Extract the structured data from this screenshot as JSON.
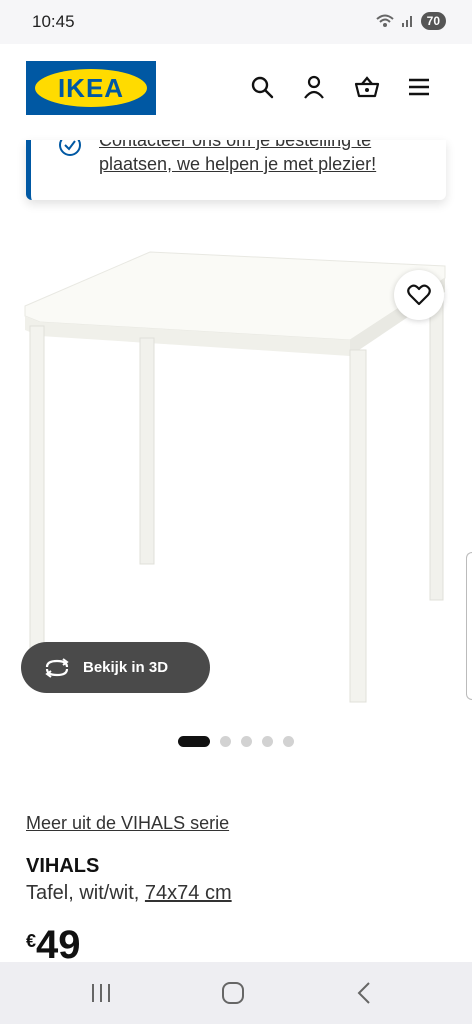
{
  "status": {
    "time": "10:45",
    "battery": "70"
  },
  "header": {
    "logo_text": "IKEA",
    "brand_blue": "#0058a3",
    "brand_yellow": "#ffdb00"
  },
  "notice": {
    "line1": "Contacteer ons om je bestelling te",
    "line2": "plaatsen, we helpen je met plezier!"
  },
  "gallery": {
    "view3d_label": "Bekijk in 3D",
    "dot_count": 5,
    "active_index": 0
  },
  "product": {
    "series_link": "Meer uit de VIHALS serie",
    "name": "VIHALS",
    "desc_prefix": "Tafel, wit/wit, ",
    "size": "74x74 cm",
    "currency": "€",
    "price": "49"
  },
  "icons": [
    "search-icon",
    "user-icon",
    "cart-icon",
    "menu-icon",
    "heart-icon",
    "rotate-3d-icon",
    "recents-icon",
    "home-icon",
    "back-icon"
  ]
}
